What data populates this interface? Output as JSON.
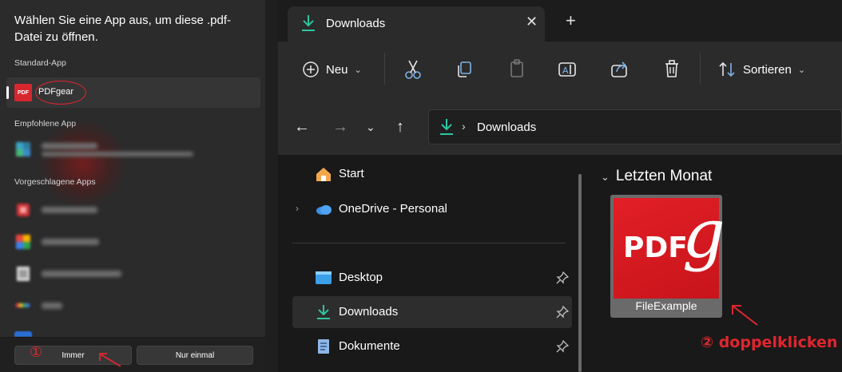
{
  "dialog": {
    "title": "Wählen Sie eine App aus, um diese .pdf-Datei zu öffnen.",
    "section_default": "Standard-App",
    "section_recommended": "Empfohlene App",
    "section_suggested": "Vorgeschlagene Apps",
    "default_app": {
      "name": "PDFgear",
      "icon_text": "PDF"
    },
    "btn_always": "Immer",
    "btn_once": "Nur einmal"
  },
  "annotations": {
    "step1_marker": "①",
    "step2_label": "② doppelklicken"
  },
  "explorer": {
    "tab_title": "Downloads",
    "toolbar": {
      "new_label": "Neu",
      "sort_label": "Sortieren"
    },
    "address": {
      "path": "Downloads"
    },
    "nav": [
      {
        "label": "Start",
        "icon": "home-icon"
      },
      {
        "label": "OneDrive - Personal",
        "icon": "onedrive-icon"
      },
      {
        "label": "Desktop",
        "icon": "desktop-icon"
      },
      {
        "label": "Downloads",
        "icon": "download-icon"
      },
      {
        "label": "Dokumente",
        "icon": "documents-icon"
      }
    ],
    "content": {
      "group": "Letzten Monat",
      "file_name": "FileExample",
      "thumb_text": "PDF",
      "thumb_script": "g"
    }
  },
  "colors": {
    "accent_red": "#e0262f",
    "download_green": "#2fc5a0",
    "onedrive_blue": "#3a8ee6"
  }
}
